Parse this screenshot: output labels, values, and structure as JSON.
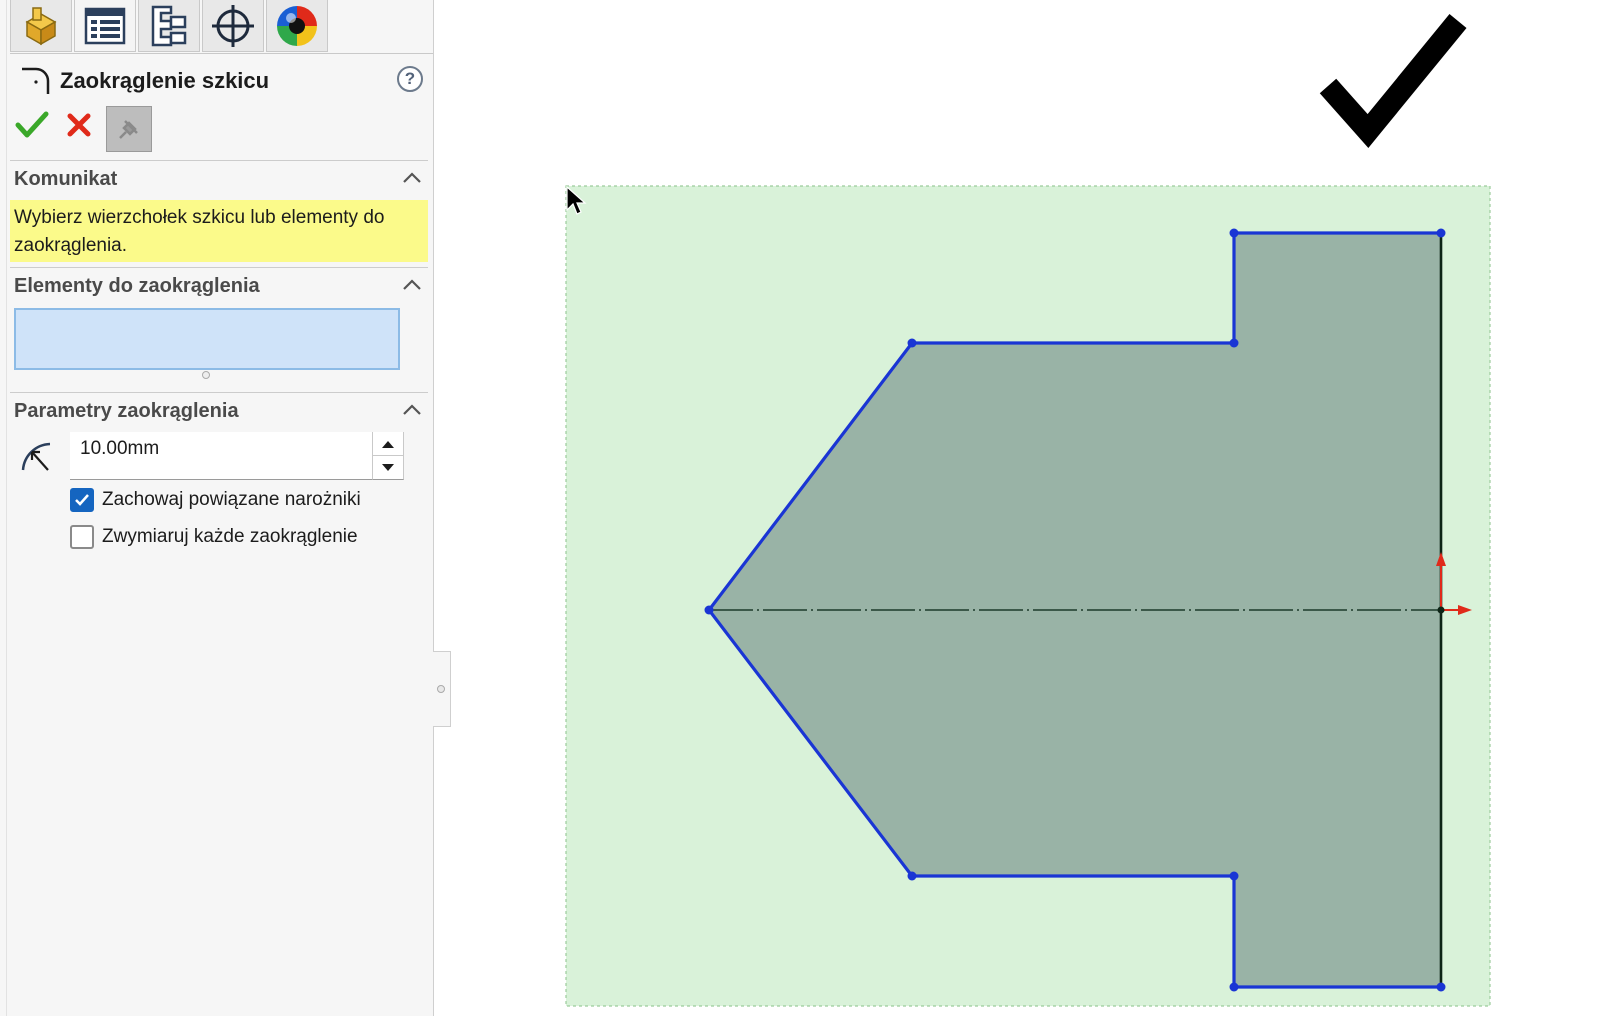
{
  "property_manager": {
    "tabs": [
      {
        "name": "feature-manager",
        "icon": "feature-manager-icon"
      },
      {
        "name": "property-manager",
        "icon": "property-manager-icon"
      },
      {
        "name": "configuration-manager",
        "icon": "configuration-manager-icon"
      },
      {
        "name": "dimxpert-manager",
        "icon": "dimxpert-crosshair-icon"
      },
      {
        "name": "display-manager",
        "icon": "display-manager-sphere-icon"
      }
    ],
    "title": "Zaokrąglenie szkicu",
    "help_label": "?",
    "sections": {
      "message": {
        "header": "Komunikat",
        "text": "Wybierz wierzchołek szkicu lub elementy do zaokrąglenia."
      },
      "entities": {
        "header": "Elementy do zaokrąglenia",
        "items": []
      },
      "parameters": {
        "header": "Parametry zaokrąglenia",
        "radius_value": "10.00mm",
        "options": [
          {
            "label": "Zachowaj powiązane narożniki",
            "checked": true
          },
          {
            "label": "Zwymiaruj każde zaokrąglenie",
            "checked": false
          }
        ]
      }
    }
  },
  "colors": {
    "sketch_line": "#1a35d4",
    "sketch_fill": "#99b3a6",
    "plane": "#d9f2d9",
    "ok_green": "#3aa829",
    "cancel_red": "#e02a1a",
    "message_bg": "#fbfa8a",
    "origin_red": "#e02a1a"
  }
}
